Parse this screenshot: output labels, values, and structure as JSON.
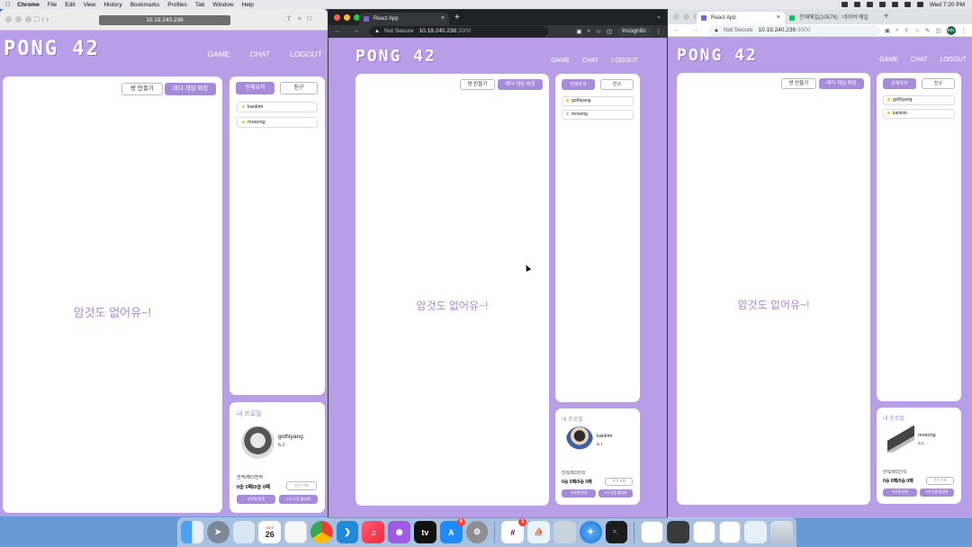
{
  "menubar": {
    "items": [
      "Chrome",
      "File",
      "Edit",
      "View",
      "History",
      "Bookmarks",
      "Profiles",
      "Tab",
      "Window",
      "Help"
    ],
    "clock": "Wed 7:20 PM"
  },
  "app": {
    "logo": "PONG 42",
    "nav": [
      "GAME",
      "CHAT",
      "LOGOUT"
    ],
    "create_room": "방 만들기",
    "ladder_match": "래더 게임 매칭",
    "empty_message": "암것도 없어유~!",
    "tab_all_users": "전체유저",
    "tab_friends": "친구",
    "profile_title": "내 프로필",
    "record_label": "전적/래더전적",
    "record_value": "0승 0패/0승 0패",
    "record_history": "전적 기록",
    "change_profile": "프로필 변경",
    "two_factor": "2차 인증 활성화"
  },
  "windows": [
    {
      "browser": "safari",
      "url": "10.19.240.236",
      "users": [
        "kankim",
        "mosong"
      ],
      "profile": {
        "name": "gotNyang",
        "level": "lv.1",
        "avatar": "cat-photo"
      }
    },
    {
      "browser": "chrome-incognito",
      "tab_title": "React App",
      "not_secure": "Not Secure",
      "host": "10.19.240.236",
      "port": ":3000",
      "incognito": "Incognito",
      "users": [
        "gotNyang",
        "mosong"
      ],
      "profile": {
        "name": "kankim",
        "level": "lv.1",
        "avatar": "cartoon-character"
      }
    },
    {
      "browser": "chrome",
      "tab_title": "React App",
      "tab2_title": "전체메일(10578) : 네이버 메일",
      "not_secure": "Not Secure",
      "host": "10.19.240.236",
      "port": ":3000",
      "users": [
        "gotNyang",
        "kankim"
      ],
      "profile": {
        "name": "mosong",
        "level": "lv.1",
        "avatar": "usb-stick"
      }
    }
  ],
  "dock": {
    "calendar_date": "26",
    "calendar_month": "OCT",
    "badges": {
      "app_store": "4",
      "slack": "1"
    },
    "icons": [
      "finder-icon",
      "launchpad-icon",
      "preview-icon",
      "calendar-icon",
      "notes-icon",
      "chrome-icon",
      "vscode-icon",
      "music-icon",
      "podcasts-icon",
      "appletv-icon",
      "appstore-icon",
      "settings-icon",
      "slack-icon",
      "docker-icon",
      "screenshot-icon",
      "safari-icon",
      "terminal-icon"
    ]
  },
  "colors": {
    "accent": "#b89ee6",
    "button": "#a58bd9",
    "panel": "#ffffff"
  }
}
